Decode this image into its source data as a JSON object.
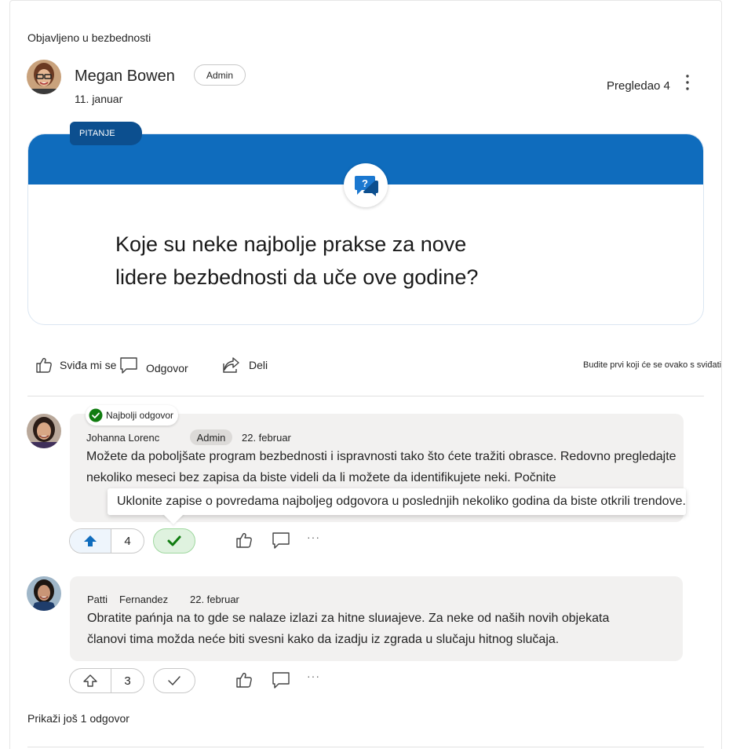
{
  "post": {
    "posted_in": "Objavljeno u bezbednosti",
    "author": "Megan Bowen",
    "author_role": "Admin",
    "date": "11. januar",
    "viewed": "Pregledao 4",
    "tag": "PITANJE",
    "question": "Koje su neke najbolje prakse za nove lidere bezbednosti da uče ove godine?",
    "question_line1": "Koje su neke najbolje prakse za nove",
    "question_line2": "lidere bezbednosti da uče ove godine?"
  },
  "actions": {
    "like": "Sviđa mi se",
    "reply": "Odgovor",
    "share": "Deli",
    "first_like": "Budite prvi koji će se ovako s sviđati"
  },
  "replies": [
    {
      "badge": "Najbolji odgovor",
      "author": "Johanna Lorenc",
      "role": "Admin",
      "date": "22. februar",
      "line1": "Možete da poboljšate program bezbednosti i ispravnosti tako što ćete tražiti obrasce. Redovno pregledajte",
      "line2": "nekoliko meseci bez zapisa da biste videli da li možete da identifikujete neki. Počnite",
      "tooltip": "Uklonite zapise o povredama najboljeg odgovora u poslednjih nekoliko godina da biste otkrili trendove.",
      "upvotes": "4",
      "more": "···"
    },
    {
      "author_first": "Patti",
      "author_last": "Fernandez",
      "date": "22. februar",
      "line1": "Obratite pańnja na to gde se nalaze izlazi za hitne sluиajeve. Za neke od naših novih objekata",
      "line2": "članovi tima možda neće biti svesni kako da izadju iz zgrada u slučaju hitnog slučaja.",
      "upvotes": "3",
      "more": "···"
    }
  ],
  "show_more": "Prikaži još 1 odgovor",
  "colors": {
    "accent": "#0f6cbd",
    "tag_bg": "#0c4f8f",
    "best_answer_green": "#107c10",
    "bubble_bg": "#f2f1f0"
  },
  "icons": [
    "more-vertical-icon",
    "question-chat-icon",
    "like-icon",
    "comment-icon",
    "share-icon",
    "checkmark-circle-icon",
    "arrow-up-icon",
    "checkmark-icon"
  ]
}
